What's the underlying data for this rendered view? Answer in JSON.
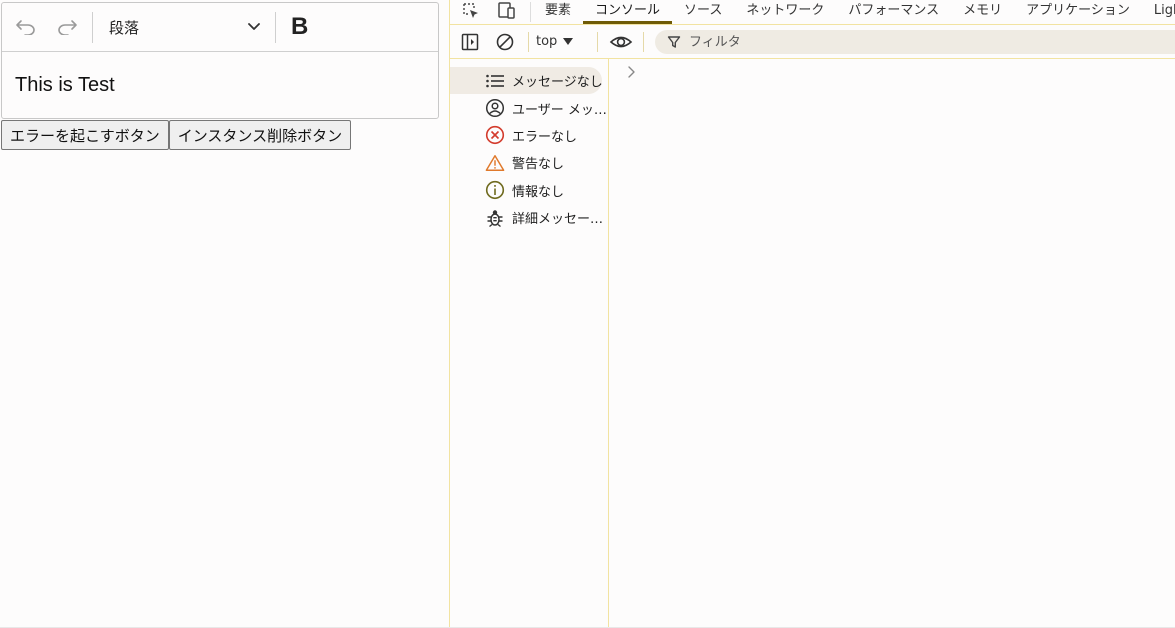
{
  "editor": {
    "block_format": "段落",
    "bold_label": "B",
    "content": "This is Test"
  },
  "buttons": {
    "error_button": "エラーを起こすボタン",
    "delete_instance_button": "インスタンス削除ボタン"
  },
  "devtools": {
    "tabs": [
      "要素",
      "コンソール",
      "ソース",
      "ネットワーク",
      "パフォーマンス",
      "メモリ",
      "アプリケーション",
      "Lighthouse"
    ],
    "active_tab": "コンソール",
    "context": "top",
    "filter_placeholder": "フィルタ",
    "sidebar": [
      {
        "label": "メッセージなし",
        "icon": "list-icon"
      },
      {
        "label": "ユーザー メッ…",
        "icon": "user-icon"
      },
      {
        "label": "エラーなし",
        "icon": "error-icon"
      },
      {
        "label": "警告なし",
        "icon": "warning-icon"
      },
      {
        "label": "情報なし",
        "icon": "info-icon"
      },
      {
        "label": "詳細メッセー…",
        "icon": "bug-icon"
      }
    ],
    "colors": {
      "accent": "#6f5b06",
      "error": "#d33b2c",
      "warning": "#e0792b",
      "info": "#6f6a1e"
    }
  }
}
